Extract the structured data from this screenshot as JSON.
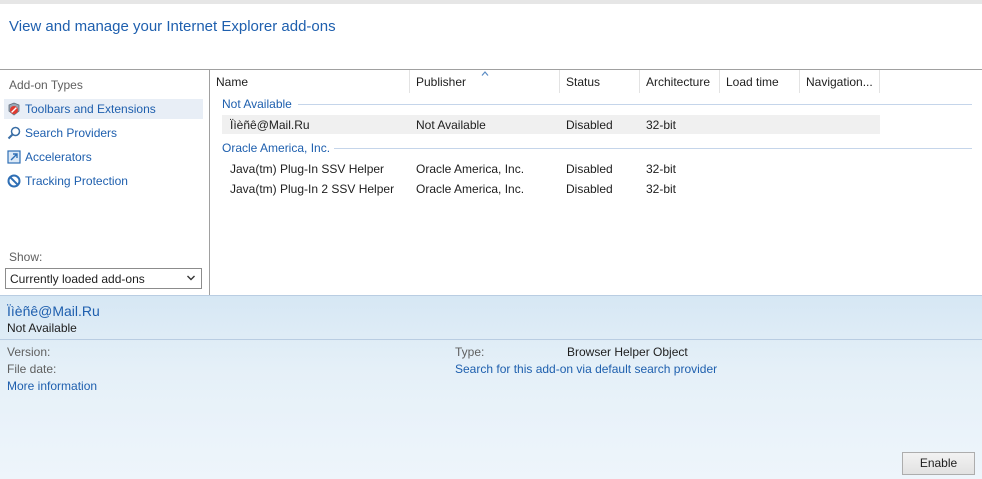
{
  "header": {
    "title": "View and manage your Internet Explorer add-ons"
  },
  "sidebar": {
    "types_title": "Add-on Types",
    "items": [
      {
        "label": "Toolbars and Extensions",
        "icon": "toolbars-extensions-icon",
        "selected": true
      },
      {
        "label": "Search Providers",
        "icon": "search-icon"
      },
      {
        "label": "Accelerators",
        "icon": "accelerators-icon"
      },
      {
        "label": "Tracking Protection",
        "icon": "tracking-protection-icon"
      }
    ],
    "show_label": "Show:",
    "show_value": "Currently loaded add-ons"
  },
  "table": {
    "columns": [
      "Name",
      "Publisher",
      "Status",
      "Architecture",
      "Load time",
      "Navigation..."
    ],
    "groups": [
      {
        "title": "Not Available",
        "rows": [
          [
            "Ïìèñê@Mail.Ru",
            "Not Available",
            "Disabled",
            "32-bit"
          ]
        ]
      },
      {
        "title": "Oracle America, Inc.",
        "rows": [
          [
            "Java(tm) Plug-In SSV Helper",
            "Oracle America, Inc.",
            "Disabled",
            "32-bit"
          ],
          [
            "Java(tm) Plug-In 2 SSV Helper",
            "Oracle America, Inc.",
            "Disabled",
            "32-bit"
          ]
        ]
      }
    ]
  },
  "details": {
    "name": "Ïìèñê@Mail.Ru",
    "publisher": "Not Available",
    "version_label": "Version:",
    "file_date_label": "File date:",
    "more_info": "More information",
    "type_label": "Type:",
    "type_value": "Browser Helper Object",
    "search_link": "Search for this add-on via default search provider",
    "enable_button": "Enable"
  }
}
